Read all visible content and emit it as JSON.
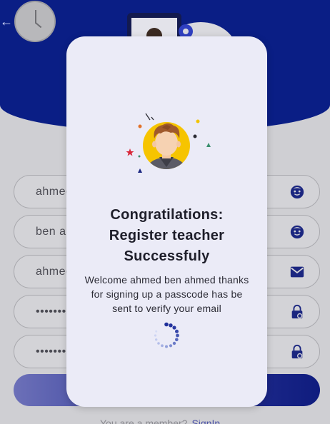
{
  "header": {
    "back_icon": "back-arrow-icon",
    "clock_icon": "clock-icon",
    "illustration": "profile-settings-illustration"
  },
  "form": {
    "fields": [
      {
        "value": "ahmed",
        "icon": "face-icon"
      },
      {
        "value": "ben ah",
        "icon": "face-icon"
      },
      {
        "value": "ahmed",
        "icon": "email-icon"
      },
      {
        "value": "•••••••",
        "icon": "lock-icon"
      },
      {
        "value": "•••••••",
        "icon": "lock-icon"
      }
    ],
    "signup_button_label": ""
  },
  "footer": {
    "text": "You are a member?",
    "link": "SignIn"
  },
  "dialog": {
    "title_line1": "Congratilations:",
    "title_line2": "Register teacher",
    "title_line3": "Successfuly",
    "message": "Welcome ahmed ben ahmed thanks for signing up a passcode has be sent to verify your email",
    "avatar_icon": "teacher-avatar-icon",
    "spinner_icon": "loading-spinner-icon"
  },
  "colors": {
    "header": "#0a1e85",
    "dialog_bg": "#ebebf7",
    "avatar_bg": "#f6c400",
    "button_gradient_start": "#6c70b8",
    "button_gradient_end": "#0f1c7e"
  }
}
